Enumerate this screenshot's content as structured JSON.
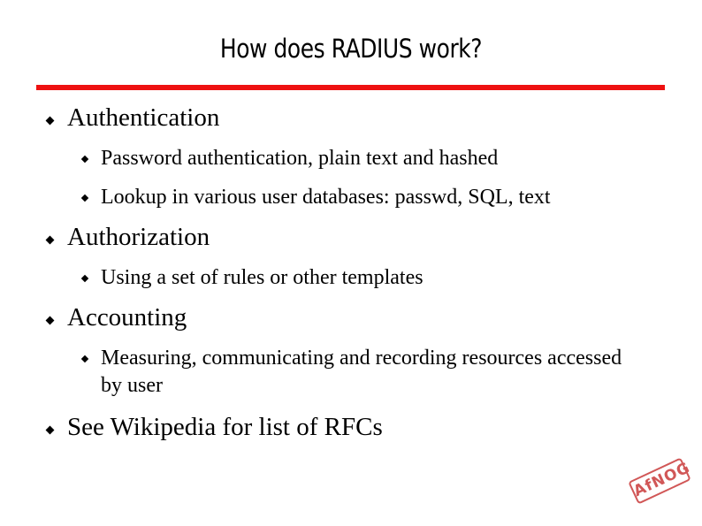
{
  "slide": {
    "title": "How does RADIUS work?",
    "accent_color": "#ee1111",
    "bullets": [
      {
        "label": "Authentication",
        "children": [
          "Password authentication, plain text and hashed",
          "Lookup in various user databases: passwd, SQL, text"
        ]
      },
      {
        "label": "Authorization",
        "children": [
          "Using a set of rules or other templates"
        ]
      },
      {
        "label": "Accounting",
        "children": [
          "Measuring, communicating and recording resources accessed by user"
        ]
      },
      {
        "label": "See Wikipedia for list of RFCs",
        "children": []
      }
    ],
    "logo": {
      "text": "AfNOG",
      "color": "#c93a3a"
    }
  }
}
